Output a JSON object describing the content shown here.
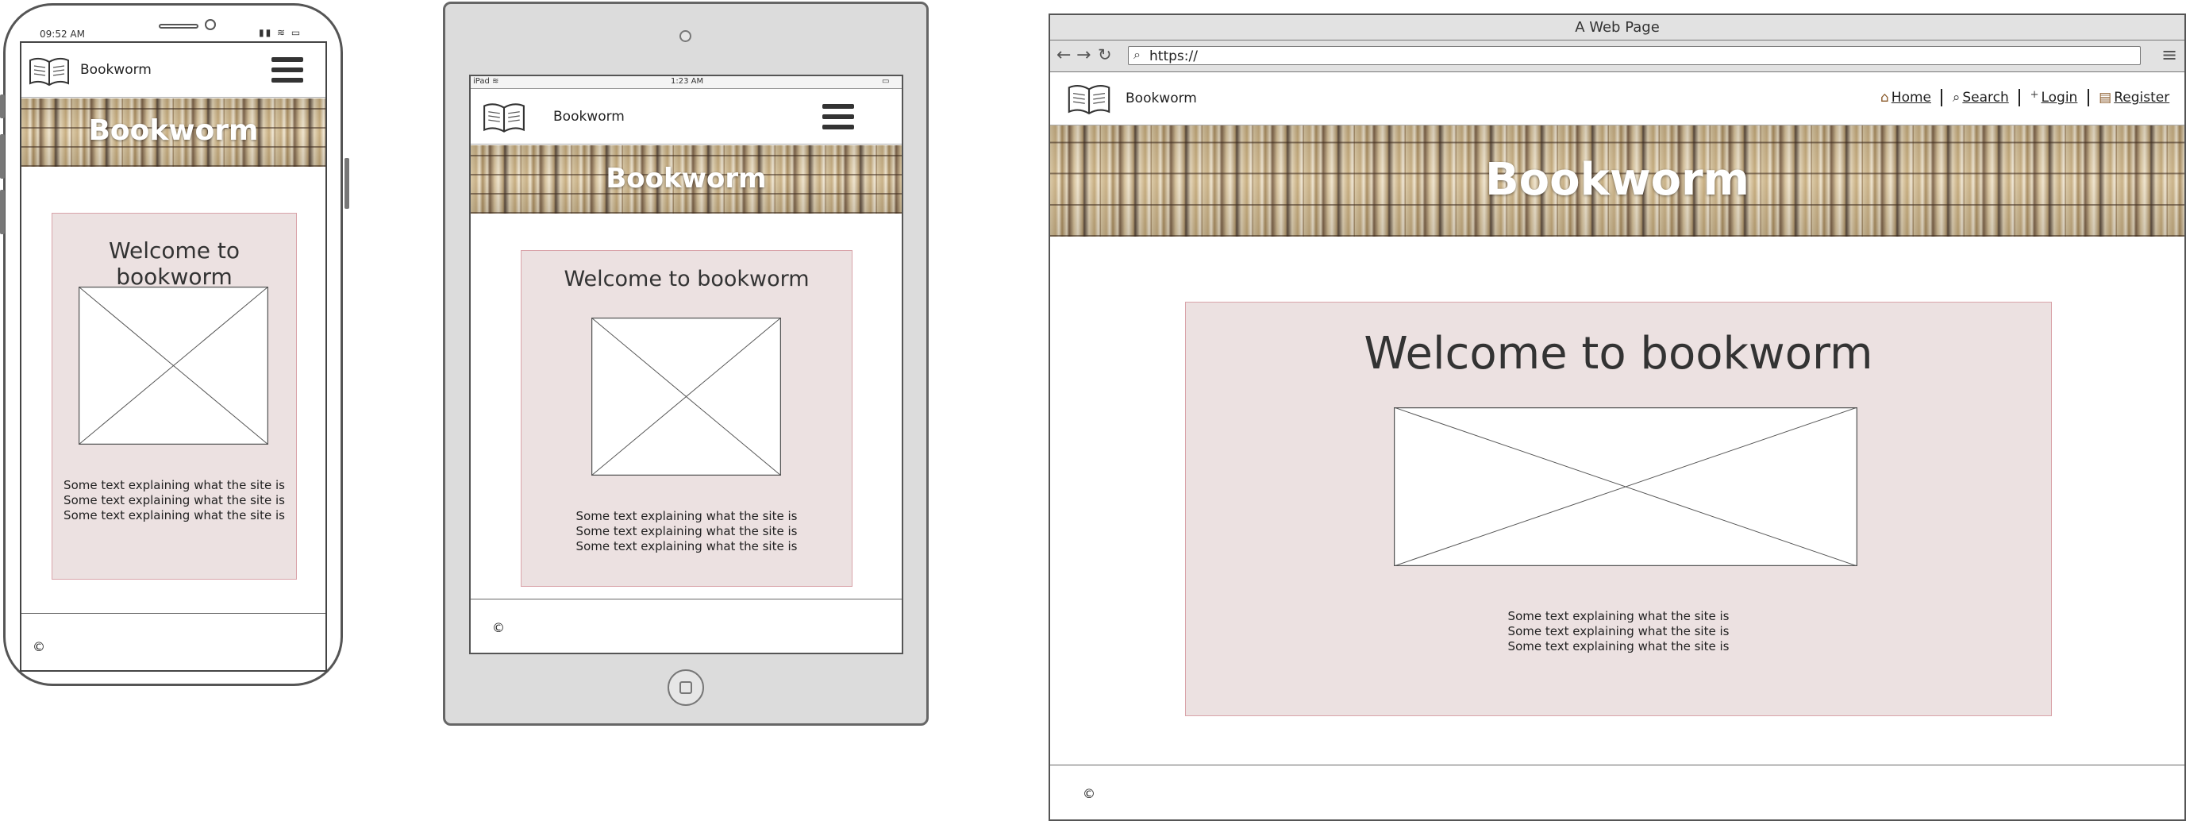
{
  "phone": {
    "status_time": "09:52 AM",
    "status_icons": "▮▮ ≋ ▭",
    "site_name": "Bookworm",
    "hero_title": "Bookworm",
    "welcome_heading": "Welcome to bookworm",
    "description_lines": [
      "Some text explaining what the site is",
      "Some text explaining what the site is",
      "Some text explaining what the site is"
    ],
    "footer_text": "©"
  },
  "tablet": {
    "status_device": "iPad ≋",
    "status_time": "1:23 AM",
    "status_battery": "▭",
    "site_name": "Bookworm",
    "hero_title": "Bookworm",
    "welcome_heading": "Welcome to bookworm",
    "description_lines": [
      "Some text explaining what the site is",
      "Some text explaining what the site is",
      "Some text explaining what the site is"
    ],
    "footer_text": "©"
  },
  "desktop": {
    "window_title": "A Web Page",
    "url": "https://",
    "site_name": "Bookworm",
    "nav": {
      "home": "Home",
      "search": "Search",
      "login": "Login",
      "register": "Register"
    },
    "hero_title": "Bookworm",
    "welcome_heading": "Welcome to bookworm",
    "description_lines": [
      "Some text explaining what the site is",
      "Some text explaining what the site is",
      "Some text explaining what the site is"
    ],
    "footer_text": "©"
  },
  "icons": {
    "logo": "open-book-icon",
    "menu": "hamburger-menu-icon",
    "placeholder": "image-placeholder-icon"
  },
  "colors": {
    "card_background": "#ece1e1",
    "card_border": "#d9a3a9",
    "device_frame": "#dcdcdc"
  }
}
